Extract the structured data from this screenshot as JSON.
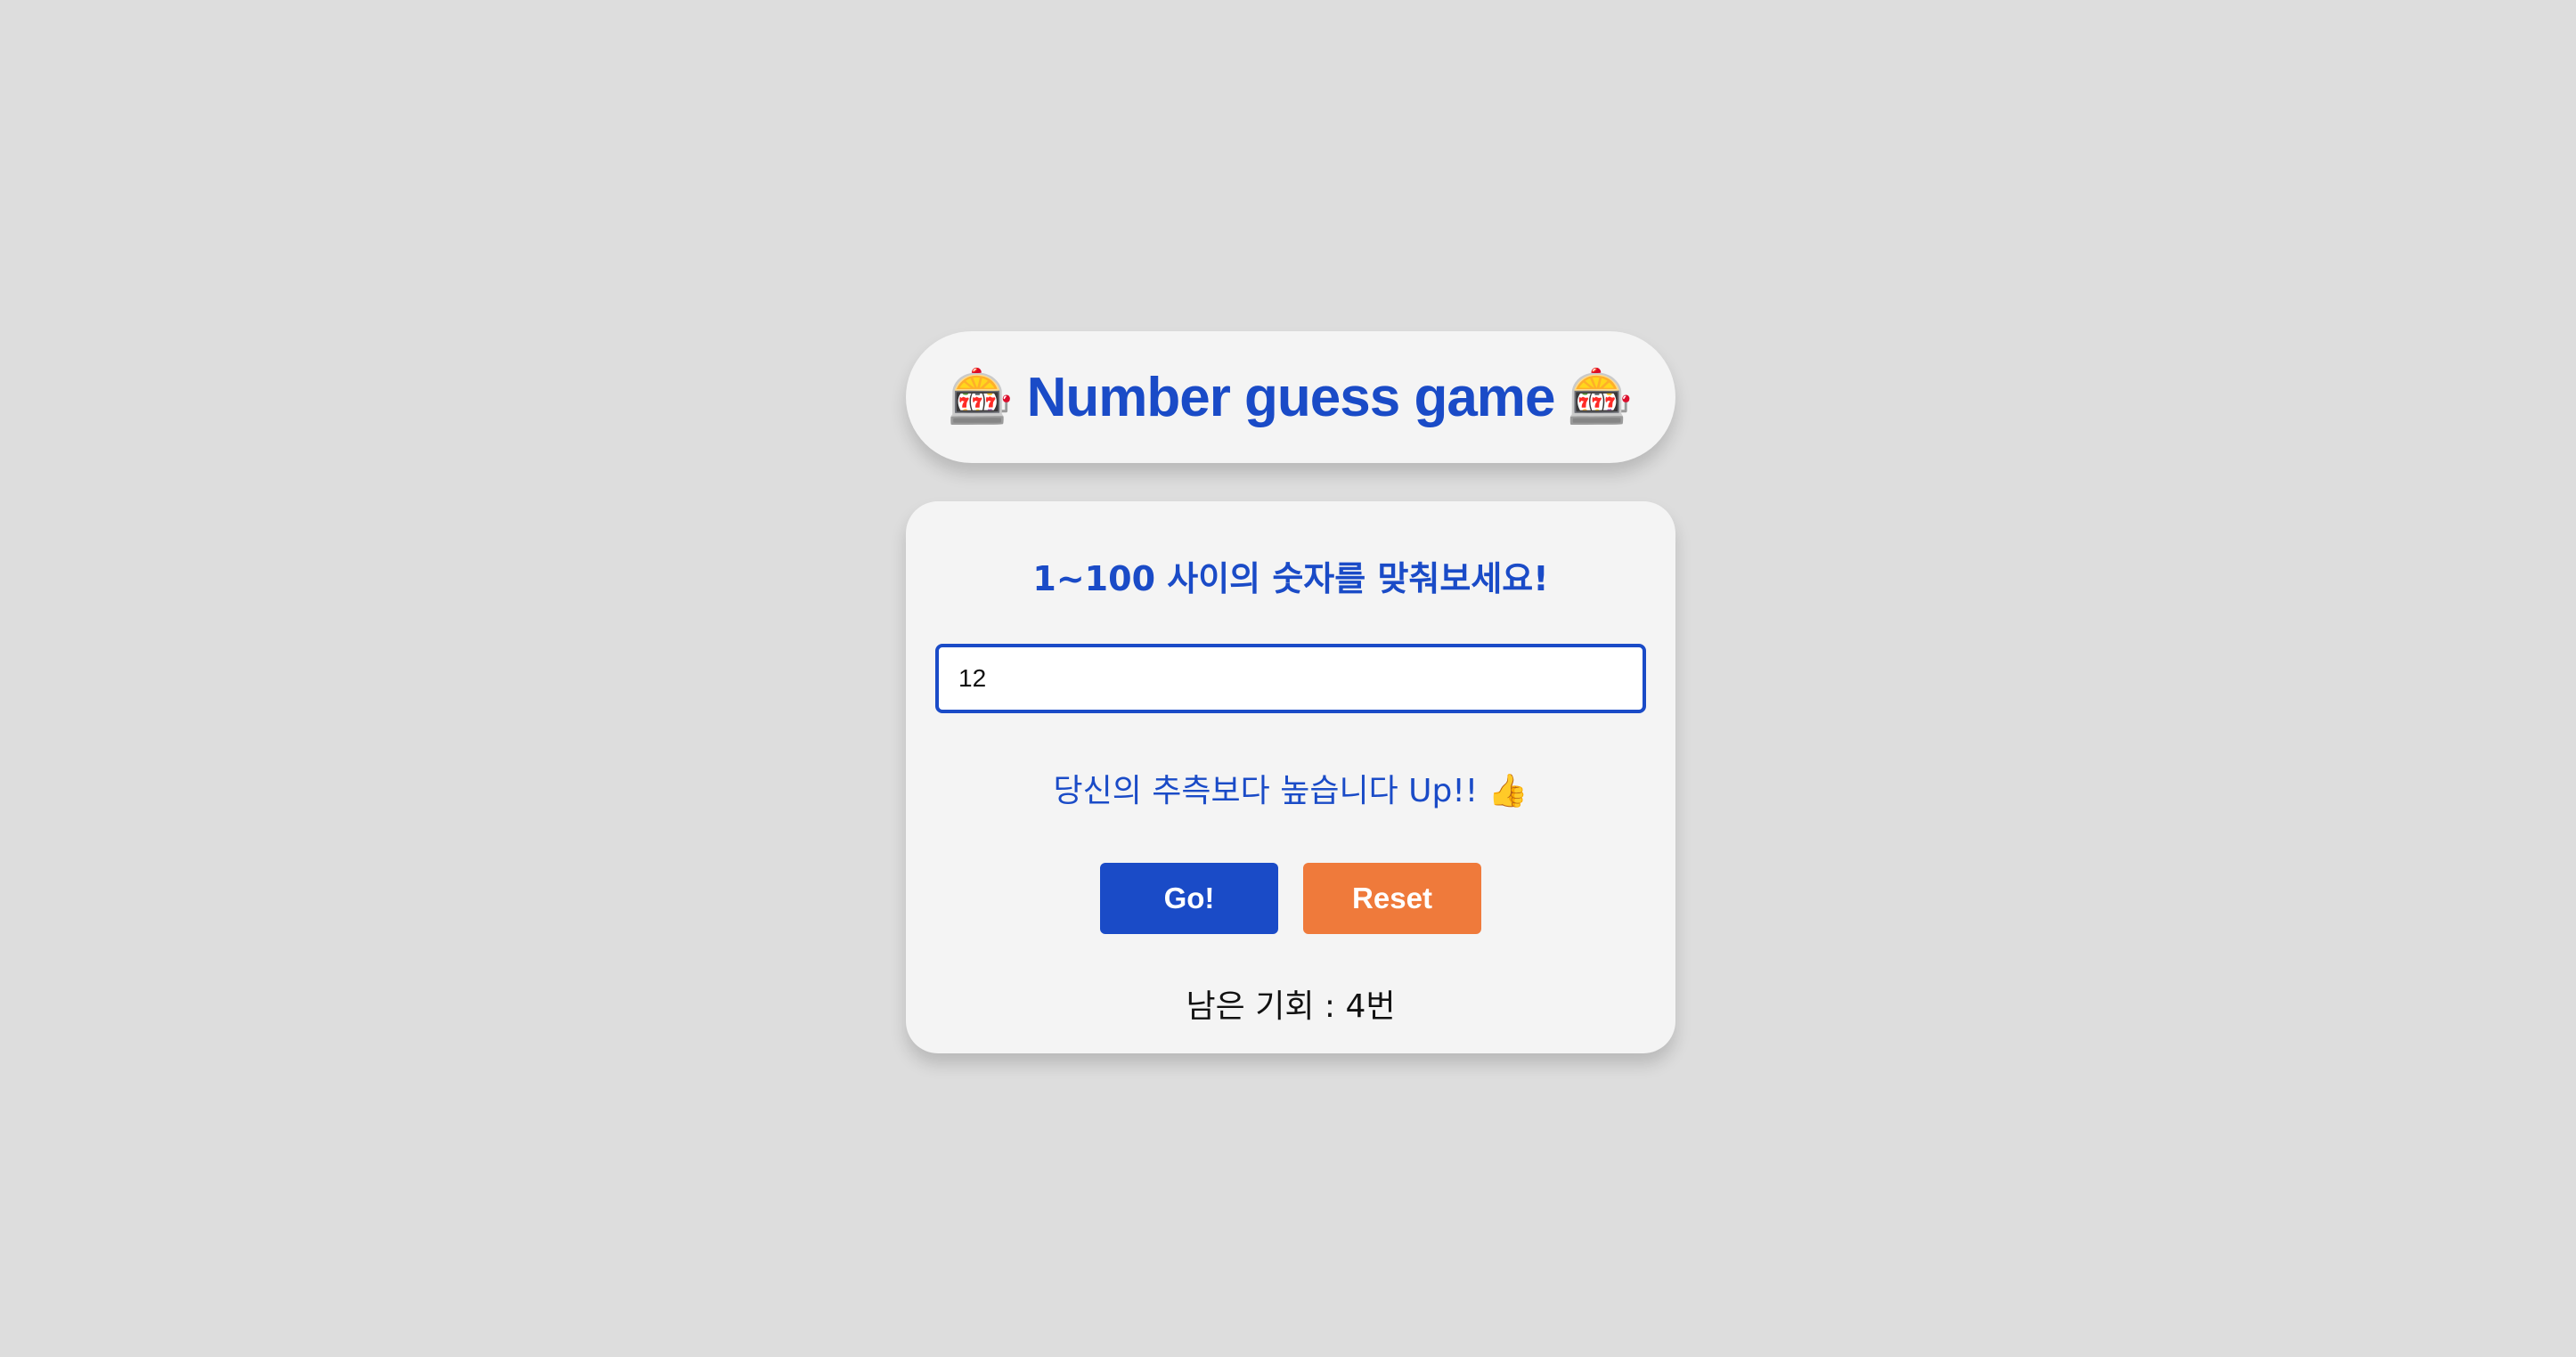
{
  "title": {
    "icon_left": "🎰",
    "text": "Number guess game",
    "icon_right": "🎰",
    "icon_name": "slot-machine-icon"
  },
  "game": {
    "prompt": "1~100 사이의 숫자를 맞춰보세요!",
    "input_value": "12",
    "result": "당신의 추측보다 높습니다 Up!! 👍",
    "go_label": "Go!",
    "reset_label": "Reset",
    "chances": "남은 기회 : 4번"
  },
  "colors": {
    "background": "#dddddd",
    "card": "#f4f4f4",
    "accent_blue": "#1a4bc7",
    "accent_orange": "#ef7a3b"
  }
}
